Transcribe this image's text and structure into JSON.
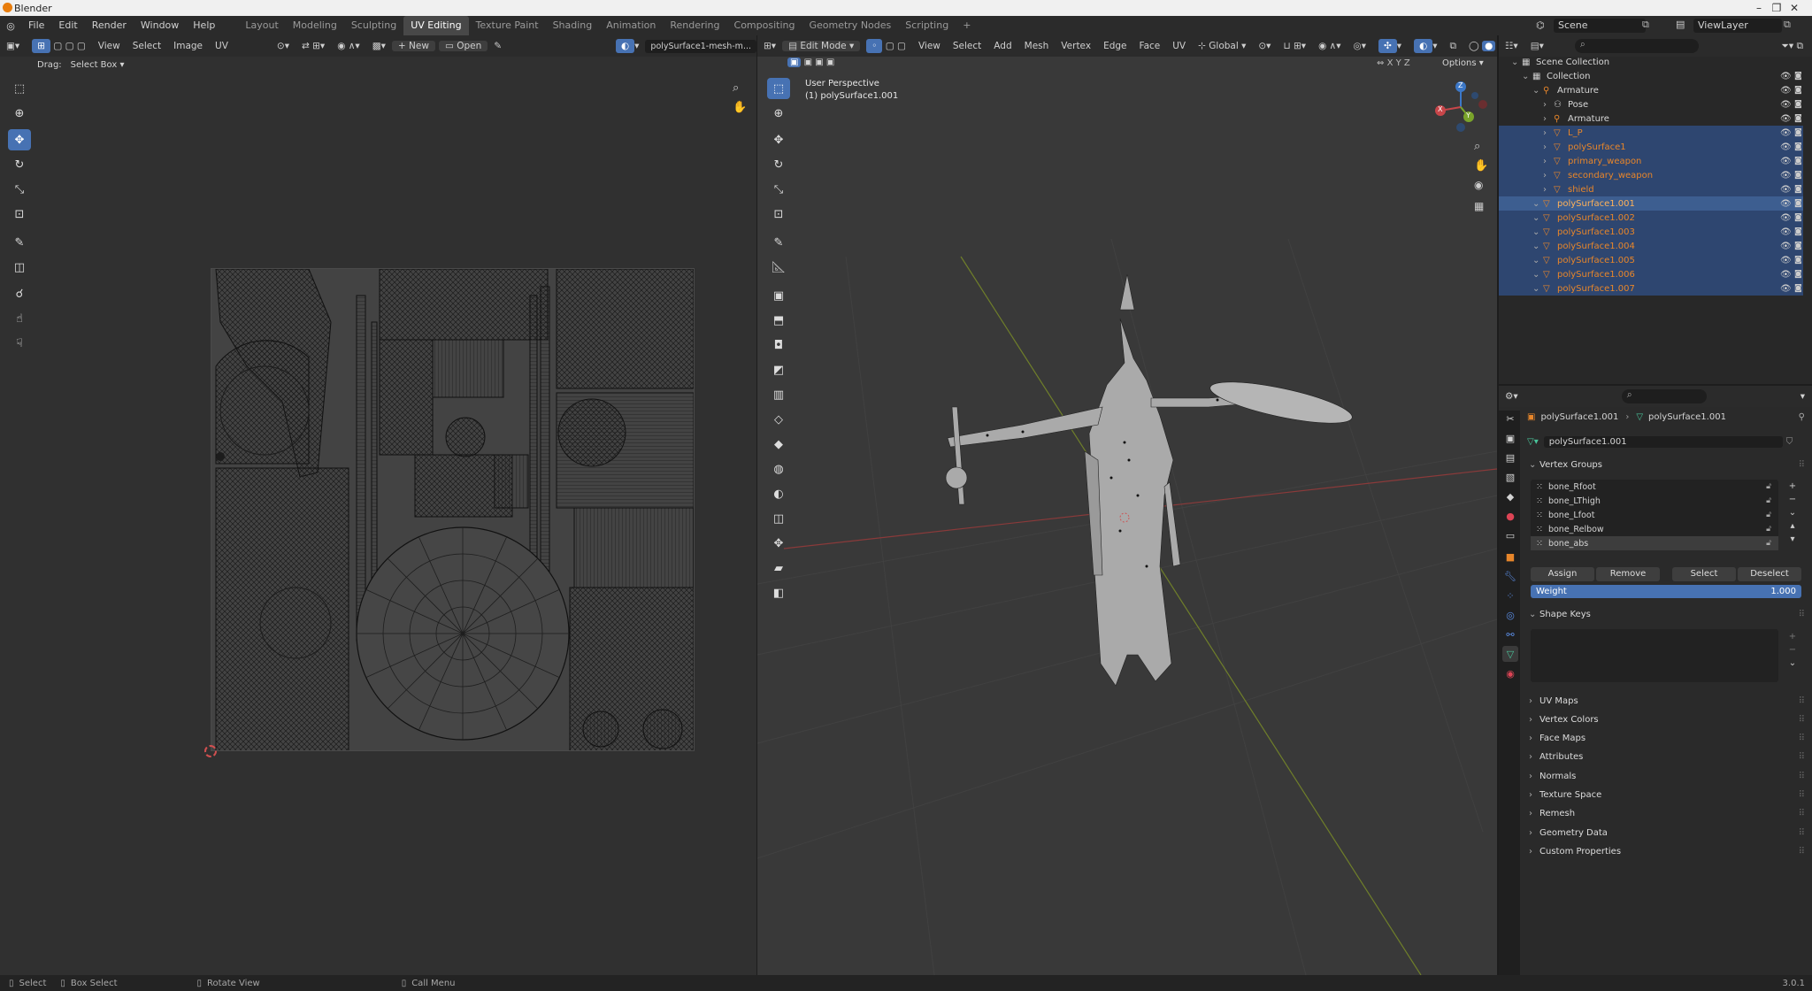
{
  "window": {
    "title": "Blender",
    "minimize": "–",
    "maximize": "❐",
    "close": "✕"
  },
  "topbar": {
    "menus": [
      "File",
      "Edit",
      "Render",
      "Window",
      "Help"
    ],
    "workspaces": [
      "Layout",
      "Modeling",
      "Sculpting",
      "UV Editing",
      "Texture Paint",
      "Shading",
      "Animation",
      "Rendering",
      "Compositing",
      "Geometry Nodes",
      "Scripting"
    ],
    "active_workspace": "UV Editing",
    "add_tab": "+",
    "scene": "Scene",
    "view_layer": "ViewLayer"
  },
  "uv_editor": {
    "header_menus": [
      "View",
      "Select",
      "Image",
      "UV"
    ],
    "new_label": "New",
    "open_label": "Open",
    "image_name": "polySurface1-mesh-m...",
    "drag_label": "Drag:",
    "drag_value": "Select Box"
  },
  "viewport": {
    "mode": "Edit Mode",
    "menus": [
      "View",
      "Select",
      "Add",
      "Mesh",
      "Vertex",
      "Edge",
      "Face",
      "UV"
    ],
    "orientation": "Global",
    "options_label": "Options",
    "axes": [
      "X",
      "Y",
      "Z"
    ],
    "perspective": "User Perspective",
    "object_label": "(1) polySurface1.001",
    "gizmo_x": "X",
    "gizmo_y": "Y",
    "gizmo_z": "Z"
  },
  "outliner": {
    "items": [
      {
        "label": "Scene Collection",
        "indent": 0,
        "state": "normal"
      },
      {
        "label": "Collection",
        "indent": 1,
        "state": "normal"
      },
      {
        "label": "Armature",
        "indent": 2,
        "state": "normal"
      },
      {
        "label": "Pose",
        "indent": 3,
        "state": "normal"
      },
      {
        "label": "Armature",
        "indent": 3,
        "state": "normal"
      },
      {
        "label": "L_P",
        "indent": 3,
        "state": "sel"
      },
      {
        "label": "polySurface1",
        "indent": 3,
        "state": "sel"
      },
      {
        "label": "primary_weapon",
        "indent": 3,
        "state": "sel"
      },
      {
        "label": "secondary_weapon",
        "indent": 3,
        "state": "sel"
      },
      {
        "label": "shield",
        "indent": 3,
        "state": "sel"
      },
      {
        "label": "polySurface1.001",
        "indent": 2,
        "state": "active"
      },
      {
        "label": "polySurface1.002",
        "indent": 2,
        "state": "sel"
      },
      {
        "label": "polySurface1.003",
        "indent": 2,
        "state": "sel"
      },
      {
        "label": "polySurface1.004",
        "indent": 2,
        "state": "sel"
      },
      {
        "label": "polySurface1.005",
        "indent": 2,
        "state": "sel"
      },
      {
        "label": "polySurface1.006",
        "indent": 2,
        "state": "sel"
      },
      {
        "label": "polySurface1.007",
        "indent": 2,
        "state": "sel"
      }
    ]
  },
  "properties": {
    "breadcrumb_object": "polySurface1.001",
    "breadcrumb_mesh": "polySurface1.001",
    "mesh_name": "polySurface1.001",
    "vertex_groups_title": "Vertex Groups",
    "vertex_groups": [
      "bone_Rfoot",
      "bone_LThigh",
      "bone_Lfoot",
      "bone_Relbow",
      "bone_abs"
    ],
    "assign": "Assign",
    "remove": "Remove",
    "select": "Select",
    "deselect": "Deselect",
    "weight_label": "Weight",
    "weight_value": "1.000",
    "shape_keys_title": "Shape Keys",
    "sections": [
      "UV Maps",
      "Vertex Colors",
      "Face Maps",
      "Attributes",
      "Normals",
      "Texture Space",
      "Remesh",
      "Geometry Data",
      "Custom Properties"
    ]
  },
  "statusbar": {
    "select": "Select",
    "box_select": "Box Select",
    "rotate_view": "Rotate View",
    "call_menu": "Call Menu",
    "version": "3.0.1"
  },
  "colors": {
    "accent": "#4772b3",
    "selected_row": "#2e4670",
    "object_orange": "#e8862a",
    "axis_red": "#a33a3a",
    "axis_green": "#6a8a2a"
  }
}
